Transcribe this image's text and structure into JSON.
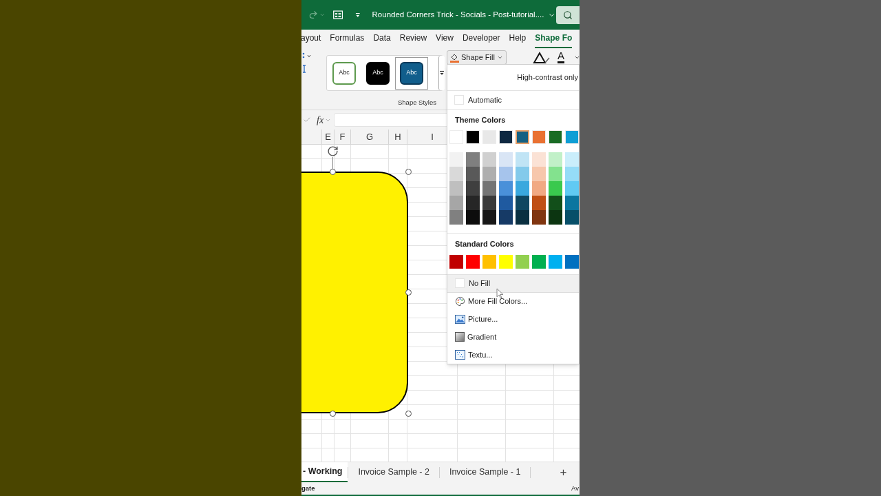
{
  "title_bar": {
    "title": "Rounded Corners Trick - Socials - Post-tutorial...."
  },
  "ribbon_tabs": [
    {
      "label": "ayout",
      "selected": false
    },
    {
      "label": "Formulas",
      "selected": false
    },
    {
      "label": "Data",
      "selected": false
    },
    {
      "label": "Review",
      "selected": false
    },
    {
      "label": "View",
      "selected": false
    },
    {
      "label": "Developer",
      "selected": false
    },
    {
      "label": "Help",
      "selected": false
    },
    {
      "label": "Shape Fo",
      "selected": true
    }
  ],
  "ribbon": {
    "shape_styles": [
      {
        "label": "Abc",
        "color": "#ffffff",
        "selected": false
      },
      {
        "label": "Abc",
        "color": "#000000",
        "selected": false
      },
      {
        "label": "Abc",
        "color": "#115e8c",
        "selected": true
      }
    ],
    "group_label": "Shape Styles",
    "shape_fill_button": "Shape Fill",
    "font_color_glyph": "A"
  },
  "formula_bar": {
    "function_label": "fx"
  },
  "column_headers": [
    "E",
    "F",
    "G",
    "H",
    "I"
  ],
  "fill_menu": {
    "high_contrast": "High-contrast only",
    "automatic": "Automatic",
    "theme_heading": "Theme Colors",
    "theme_colors": [
      {
        "color": "#ffffff",
        "selected": false,
        "shades": [
          {
            "color": "#f2f2f2"
          },
          {
            "color": "#d9d9d9"
          },
          {
            "color": "#bfbfbf"
          },
          {
            "color": "#a6a6a6"
          },
          {
            "color": "#808080"
          }
        ]
      },
      {
        "color": "#000000",
        "selected": false,
        "shades": [
          {
            "color": "#7f7f7f"
          },
          {
            "color": "#595959"
          },
          {
            "color": "#3f3f3f"
          },
          {
            "color": "#262626"
          },
          {
            "color": "#0d0d0d"
          }
        ]
      },
      {
        "color": "#e8e8e8",
        "selected": false,
        "shades": [
          {
            "color": "#d0d0d0"
          },
          {
            "color": "#aeaeae"
          },
          {
            "color": "#757575"
          },
          {
            "color": "#3a3a3a"
          },
          {
            "color": "#171717"
          }
        ]
      },
      {
        "color": "#0e2841",
        "selected": false,
        "shades": [
          {
            "color": "#d9e5f5"
          },
          {
            "color": "#a6c4ec"
          },
          {
            "color": "#4a90d9"
          },
          {
            "color": "#1f5aa0"
          },
          {
            "color": "#163a66"
          }
        ]
      },
      {
        "color": "#156082",
        "selected": true,
        "shades": [
          {
            "color": "#c0e4f5"
          },
          {
            "color": "#83caeb"
          },
          {
            "color": "#3aa8de"
          },
          {
            "color": "#0f4761"
          },
          {
            "color": "#0a2f40"
          }
        ]
      },
      {
        "color": "#e97132",
        "selected": false,
        "shades": [
          {
            "color": "#fbe2d5"
          },
          {
            "color": "#f7c7ac"
          },
          {
            "color": "#f1a983"
          },
          {
            "color": "#c04f15"
          },
          {
            "color": "#803510"
          }
        ]
      },
      {
        "color": "#196b24",
        "selected": false,
        "shades": [
          {
            "color": "#c1f0c8"
          },
          {
            "color": "#83e28e"
          },
          {
            "color": "#3ac94e"
          },
          {
            "color": "#124f1a"
          },
          {
            "color": "#0c3511"
          }
        ]
      },
      {
        "color": "#0f9ed5",
        "selected": false,
        "shades": [
          {
            "color": "#caeefb"
          },
          {
            "color": "#95dcf7"
          },
          {
            "color": "#60caf3"
          },
          {
            "color": "#0b76a0"
          },
          {
            "color": "#074f69"
          }
        ]
      }
    ],
    "standard_heading": "Standard Colors",
    "standard_colors": [
      {
        "color": "#c00000"
      },
      {
        "color": "#ff0000"
      },
      {
        "color": "#ffc000"
      },
      {
        "color": "#ffff00"
      },
      {
        "color": "#92d050"
      },
      {
        "color": "#00b050"
      },
      {
        "color": "#00b0f0"
      },
      {
        "color": "#0070c0"
      }
    ],
    "items": [
      {
        "kind": "nofill",
        "label": "No Fill",
        "hovered": true
      },
      {
        "kind": "palette",
        "label": "More Fill Colors...",
        "hovered": false
      },
      {
        "kind": "picture",
        "label": "Picture...",
        "hovered": false
      },
      {
        "kind": "gradient",
        "label": "Gradient",
        "hovered": false
      },
      {
        "kind": "texture",
        "label": "Textu...",
        "hovered": false
      }
    ]
  },
  "sheet_tabs": [
    {
      "label": "- Working",
      "selected": true
    },
    {
      "label": "Invoice Sample - 2",
      "selected": false
    },
    {
      "label": "Invoice Sample - 1",
      "selected": false
    }
  ],
  "add_sheet": "+",
  "status_bar": {
    "left": "gate",
    "right": "Av"
  }
}
